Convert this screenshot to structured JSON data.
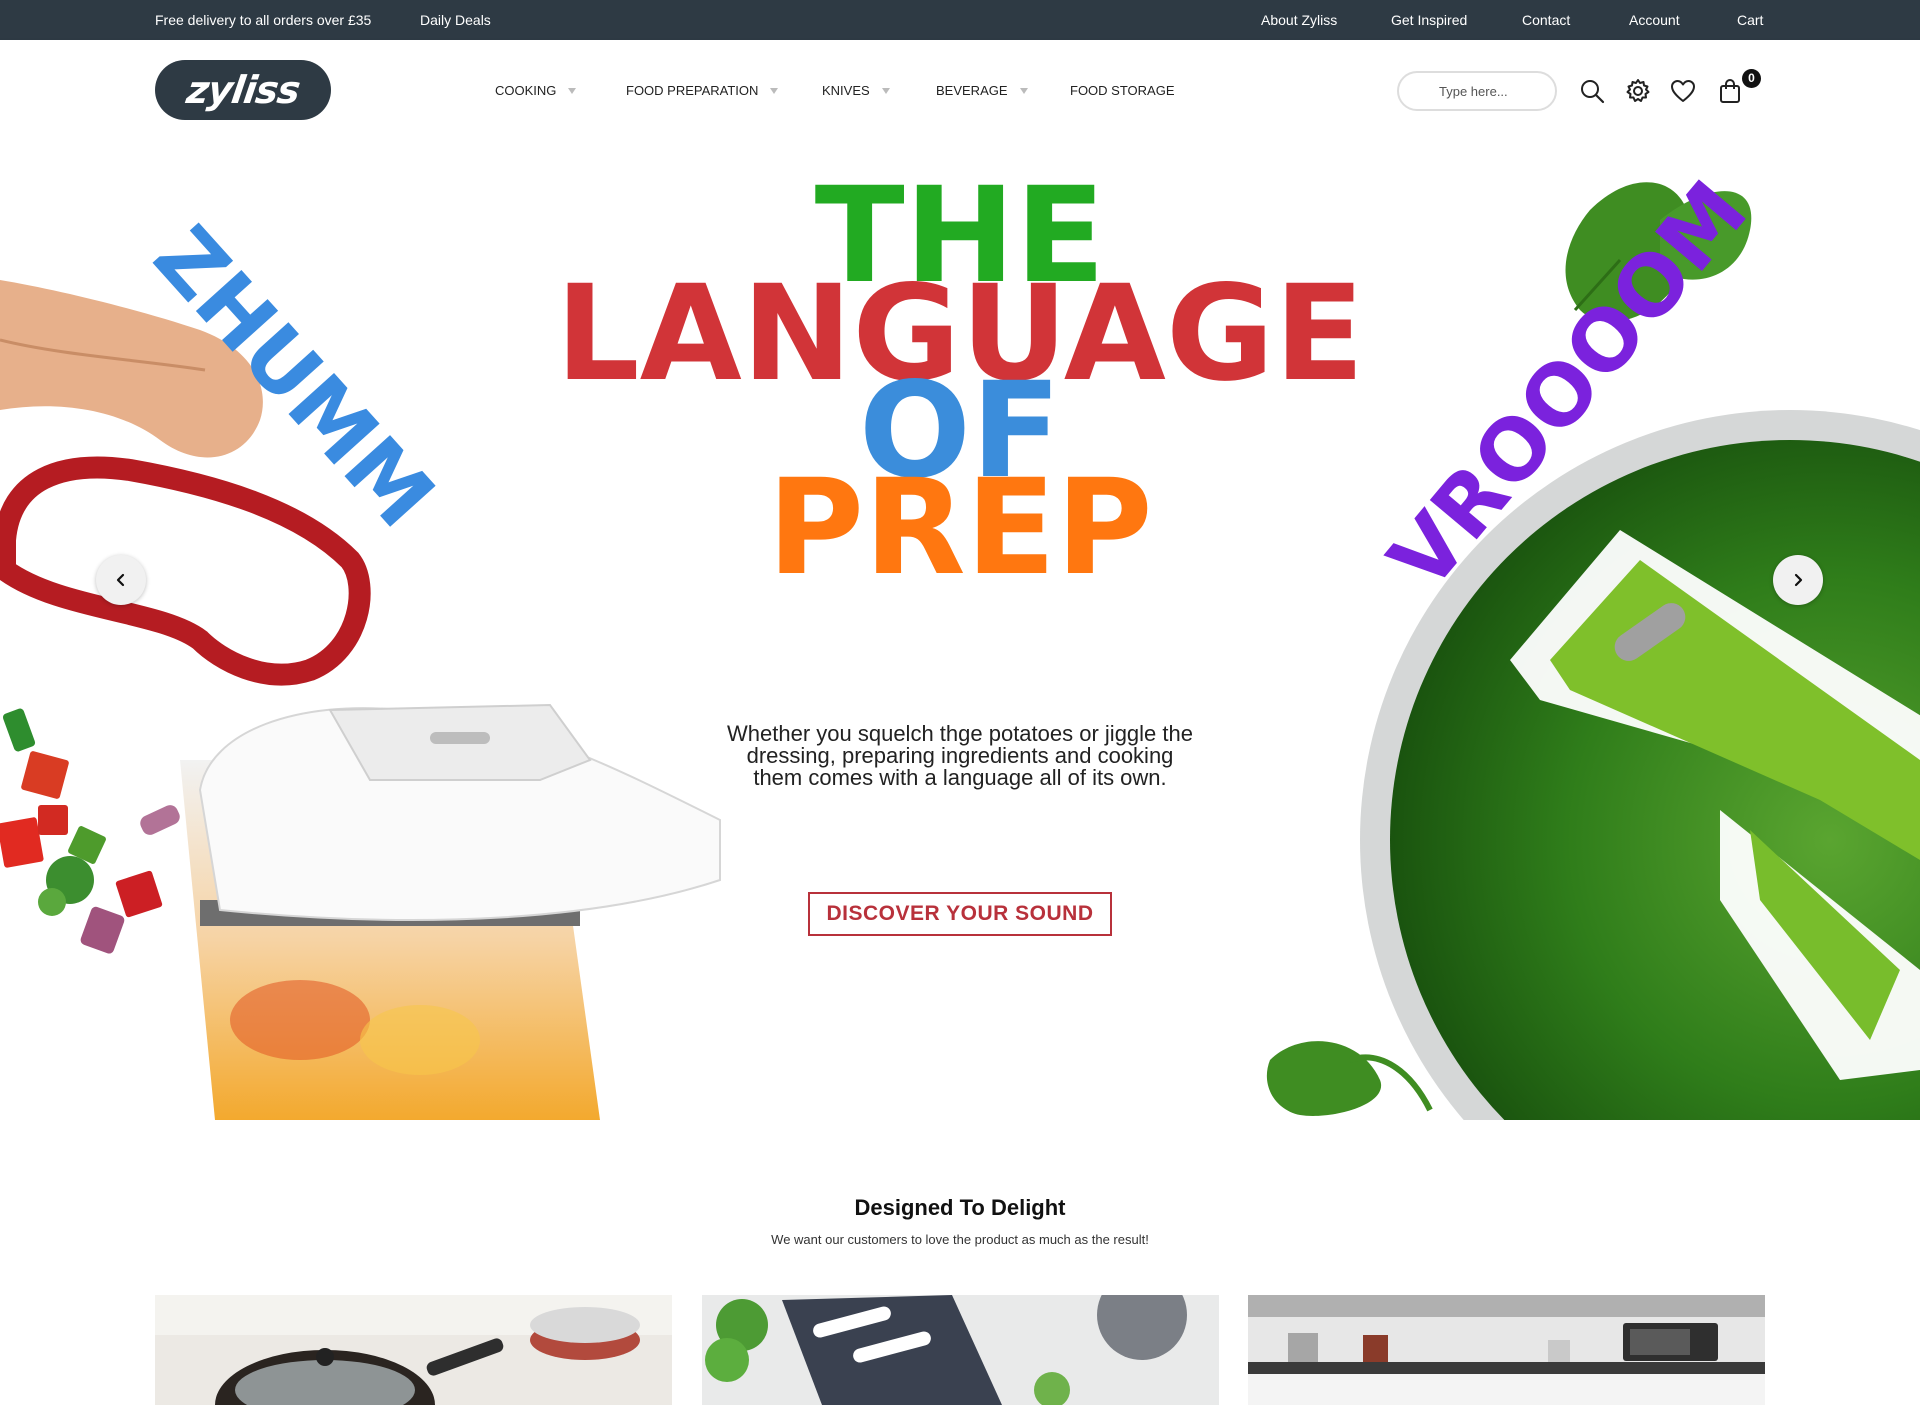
{
  "topbar": {
    "delivery": "Free delivery to all orders over £35",
    "deals": "Daily Deals",
    "links": [
      "About Zyliss",
      "Get Inspired",
      "Contact",
      "Account",
      "Cart"
    ]
  },
  "header": {
    "logo": "zyliss",
    "nav": [
      "COOKING",
      "FOOD PREPARATION",
      "KNIVES",
      "BEVERAGE",
      "FOOD STORAGE"
    ],
    "search_placeholder": "Type here...",
    "cart_count": "0",
    "icons": [
      "search-icon",
      "settings-gear-icon",
      "heart-icon",
      "shopping-bag-icon"
    ]
  },
  "hero": {
    "line1": "THE",
    "line2": "LANGUAGE",
    "line3": "OF",
    "line4": "PREP",
    "left_word": "ZHUMM",
    "right_word": "VROOOOM",
    "subtext_1": "Whether you squelch thge potatoes or jiggle the",
    "subtext_2": "dressing, preparing ingredients and cooking",
    "subtext_3": "them comes with a language all of its own.",
    "cta": "DISCOVER YOUR SOUND",
    "colors": {
      "the": "#22aa22",
      "language": "#d13438",
      "of": "#3b8ddb",
      "prep": "#ff7710",
      "zhumm": "#3a8be0",
      "vroooom": "#7b22dd",
      "cta": "#b8313b"
    }
  },
  "section": {
    "title": "Designed To Delight",
    "subtitle": "We want our customers to love the product as much as the result!"
  }
}
